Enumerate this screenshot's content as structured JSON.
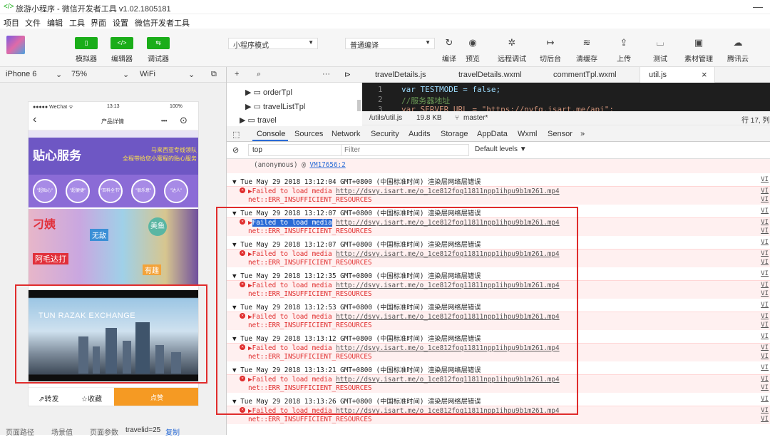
{
  "window": {
    "title": "旅游小程序 - 微信开发者工具 v1.02.1805181",
    "minimize": "—"
  },
  "menu": [
    "项目",
    "文件",
    "编辑",
    "工具",
    "界面",
    "设置",
    "微信开发者工具"
  ],
  "toolbar": {
    "left_buttons": [
      {
        "label": "模拟器",
        "icon": "phone-icon"
      },
      {
        "label": "编辑器",
        "icon": "code-icon"
      },
      {
        "label": "调试器",
        "icon": "debug-icon"
      }
    ],
    "mode_select": "小程序模式",
    "compile_select": "普通编译",
    "right_buttons": [
      {
        "label": "编译",
        "icon": "refresh-icon",
        "glyph": "↻"
      },
      {
        "label": "预览",
        "icon": "eye-icon",
        "glyph": "◉"
      },
      {
        "label": "远程调试",
        "icon": "bug-icon",
        "glyph": "✲"
      },
      {
        "label": "切后台",
        "icon": "switch-icon",
        "glyph": "↦"
      },
      {
        "label": "清缓存",
        "icon": "layers-icon",
        "glyph": "≋"
      },
      {
        "label": "上传",
        "icon": "upload-icon",
        "glyph": "⇪"
      },
      {
        "label": "测试",
        "icon": "flask-icon",
        "glyph": "⌴"
      },
      {
        "label": "素材管理",
        "icon": "folder-icon",
        "glyph": "▣"
      },
      {
        "label": "腾讯云",
        "icon": "cloud-icon",
        "glyph": "☁"
      }
    ]
  },
  "devbar": {
    "device": "iPhone 6",
    "zoom": "75%",
    "network": "WiFi",
    "editor_tabs": [
      "travelDetails.js",
      "travelDetails.wxml",
      "commentTpl.wxml",
      "util.js"
    ],
    "close": "×"
  },
  "phone": {
    "status_left": "●●●●● WeChat ᯤ",
    "status_time": "13:13",
    "status_right": "100%",
    "nav_title": "产品详情",
    "nav_back": "‹",
    "nav_more": "•••",
    "nav_record": "⊙",
    "banner_big": "贴心服务",
    "banner_sub1": "马来西亚专线领队",
    "banner_sub2": "全程带给您小蜜程的贴心服务",
    "circles": [
      "\"超贴心\"",
      "\"超便捷\"",
      "\"百科全书\"",
      "\"很乐意\"",
      "\"达人\""
    ],
    "photo_tag1": "刁姨",
    "photo_tag2": "阿毛达打",
    "photo_tag3": "无敌",
    "photo_tag4": "美鱼",
    "photo_tag5": "有趣",
    "video_title": "TUN RAZAK EXCHANGE",
    "share": "转发",
    "fav": "收藏",
    "cta": "点赞"
  },
  "sim_footer": {
    "path": "页面路径",
    "scene": "场景值",
    "params": "页面参数",
    "param_value": "travelid=25",
    "copy": "复制"
  },
  "tree": [
    {
      "label": "orderTpl"
    },
    {
      "label": "travelListTpl"
    },
    {
      "label": "travel"
    }
  ],
  "code": {
    "lines": [
      {
        "num": "1",
        "text": "var TESTMODE = false;"
      },
      {
        "num": "2",
        "text": "//服务器地址"
      },
      {
        "num": "3",
        "text": "var SERVER_URL = \"https://nvfq.isart.me/api\";"
      }
    ]
  },
  "fileinfo": {
    "path": "/utils/util.js",
    "size": "19.8 KB",
    "branch": "master*",
    "pos": "行 17, 列"
  },
  "devtools_tabs": [
    "Console",
    "Sources",
    "Network",
    "Security",
    "Audits",
    "Storage",
    "AppData",
    "Wxml",
    "Sensor",
    "»"
  ],
  "filter": {
    "context": "top",
    "placeholder": "Filter",
    "levels": "Default levels ▼"
  },
  "console": {
    "anon": "(anonymous) @ ",
    "anon_link": "VM17656:2",
    "err_prefix": "▶Failed to load media ",
    "err_url": "http://dsvy.isart.me/o_1ce812foq11811npp1ihpu9b1m261.mp4",
    "err_code": "net::ERR_INSUFFICIENT_RESOURCES",
    "vm": "VI",
    "groups": [
      "Tue May 29 2018 13:12:04 GMT+0800 (中国标准时间) 渲染层网络层错误",
      "Tue May 29 2018 13:12:07 GMT+0800 (中国标准时间) 渲染层网络层错误",
      "Tue May 29 2018 13:12:07 GMT+0800 (中国标准时间) 渲染层网络层错误",
      "Tue May 29 2018 13:12:35 GMT+0800 (中国标准时间) 渲染层网络层错误",
      "Tue May 29 2018 13:12:53 GMT+0800 (中国标准时间) 渲染层网络层错误",
      "Tue May 29 2018 13:13:12 GMT+0800 (中国标准时间) 渲染层网络层错误",
      "Tue May 29 2018 13:13:21 GMT+0800 (中国标准时间) 渲染层网络层错误",
      "Tue May 29 2018 13:13:26 GMT+0800 (中国标准时间) 渲染层网络层错误"
    ],
    "highlight": "Failed to load media"
  },
  "colors": {
    "accent_green": "#1aad19",
    "error_red": "#e02c2c",
    "cta_orange": "#f59a23"
  }
}
